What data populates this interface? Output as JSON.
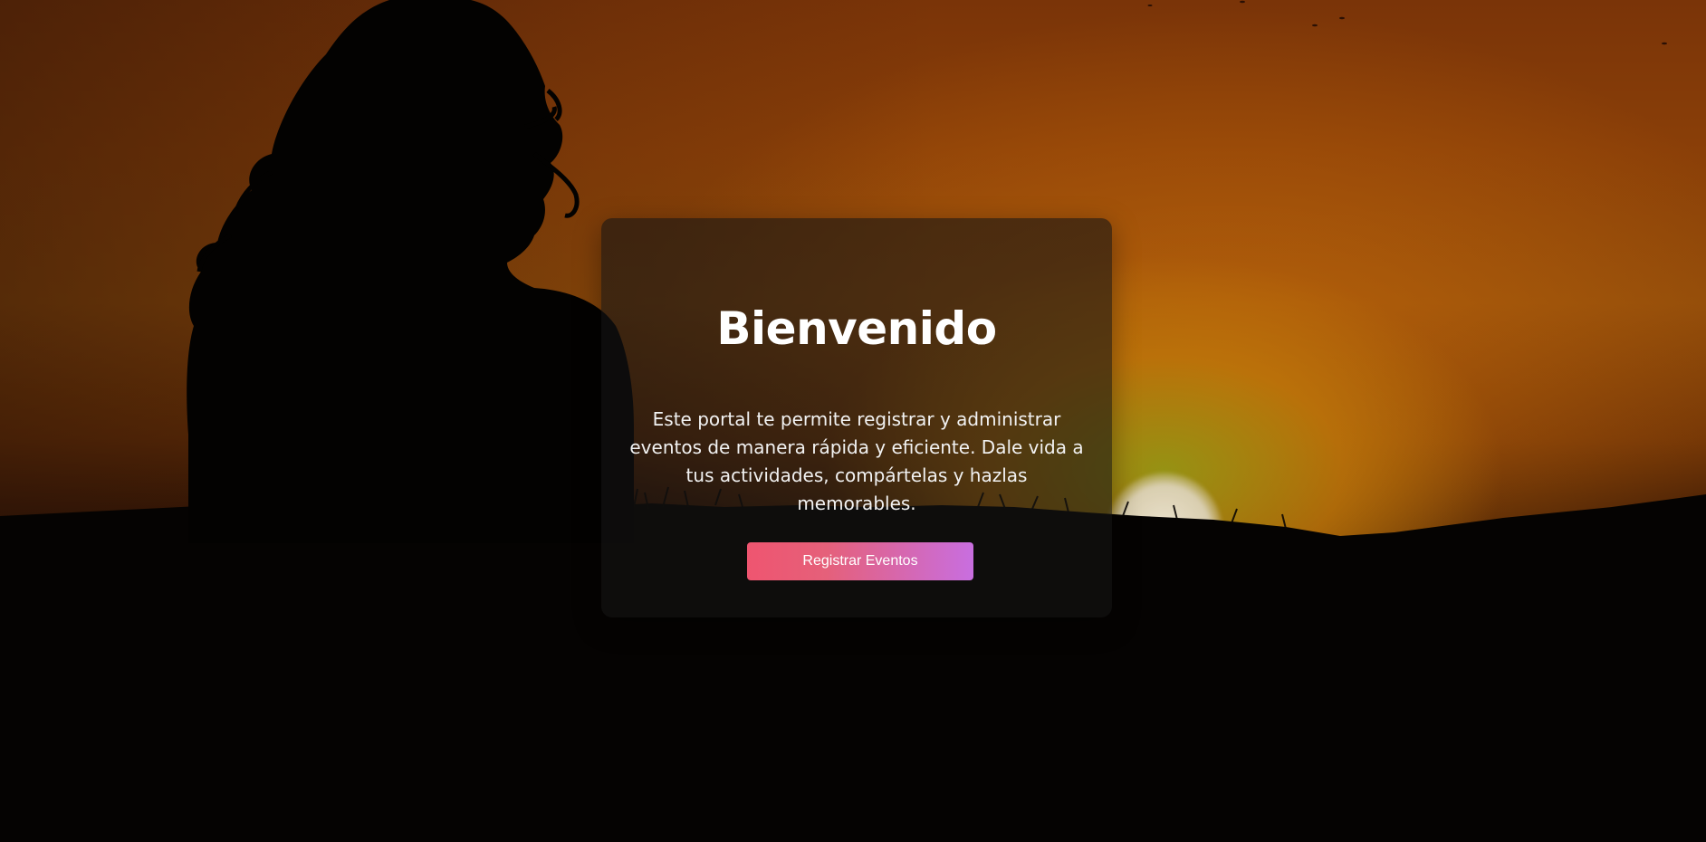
{
  "hero": {
    "background_image": "sunset-silhouette-woman",
    "accent_colors": {
      "sky_orange": "#8a3f08",
      "sun_glow": "#b2a010",
      "card_background": "rgba(20,20,20,0.6)",
      "button_gradient_start": "#ef5570",
      "button_gradient_end": "#c86ee0"
    }
  },
  "welcome_card": {
    "title": "Bienvenido",
    "description": "Este portal te permite registrar y administrar eventos de manera rápida y eficiente. Dale vida a tus actividades, compártelas y hazlas memorables.",
    "button_label": "Registrar Eventos"
  }
}
